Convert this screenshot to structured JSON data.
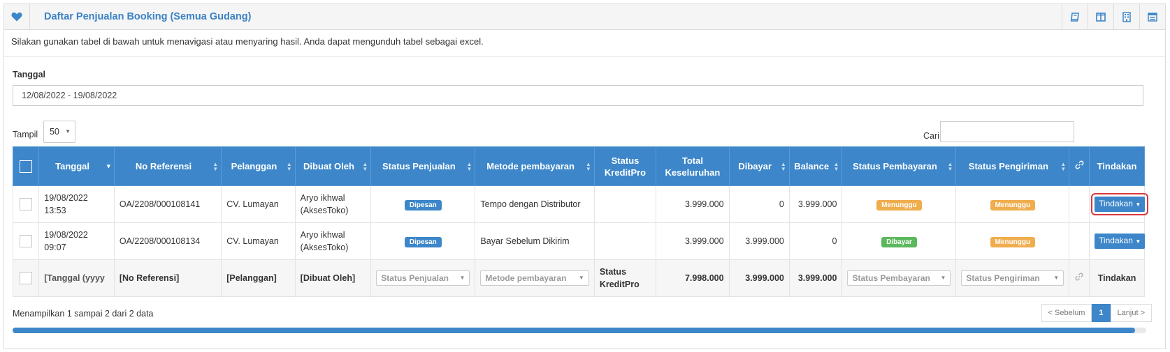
{
  "panel": {
    "title": "Daftar Penjualan Booking (Semua Gudang)",
    "title_icon": "heart-icon",
    "tools": [
      "book-icon",
      "columns-icon",
      "building-icon",
      "list-icon"
    ],
    "intro": "Silakan gunakan tabel di bawah untuk menavigasi atau menyaring hasil. Anda dapat mengunduh tabel sebagai excel."
  },
  "filter": {
    "date_label": "Tanggal",
    "date_value": "12/08/2022 - 19/08/2022"
  },
  "controls": {
    "show_label": "Tampil",
    "show_value": "50",
    "search_label": "Cari",
    "search_value": ""
  },
  "table": {
    "headers": {
      "tanggal": "Tanggal",
      "no_ref": "No Referensi",
      "pelanggan": "Pelanggan",
      "dibuat_oleh": "Dibuat Oleh",
      "status_penjualan": "Status Penjualan",
      "metode": "Metode pembayaran",
      "kreditpro": "Status KreditPro",
      "total": "Total Keseluruhan",
      "dibayar": "Dibayar",
      "balance": "Balance",
      "status_pembayaran": "Status Pembayaran",
      "status_pengiriman": "Status Pengiriman",
      "tindakan": "Tindakan"
    },
    "rows": [
      {
        "tanggal": "19/08/2022 13:53",
        "no_ref": "OA/2208/000108141",
        "pelanggan": "CV. Lumayan",
        "dibuat_oleh": "Aryo ikhwal (AksesToko)",
        "status_penjualan": "Dipesan",
        "metode": "Tempo dengan Distributor",
        "kreditpro": "",
        "total": "3.999.000",
        "dibayar": "0",
        "balance": "3.999.000",
        "status_pembayaran": "Menunggu",
        "status_pengiriman": "Menunggu",
        "action": "Tindakan"
      },
      {
        "tanggal": "19/08/2022 09:07",
        "no_ref": "OA/2208/000108134",
        "pelanggan": "CV. Lumayan",
        "dibuat_oleh": "Aryo ikhwal (AksesToko)",
        "status_penjualan": "Dipesan",
        "metode": "Bayar Sebelum Dikirim",
        "kreditpro": "",
        "total": "3.999.000",
        "dibayar": "3.999.000",
        "balance": "0",
        "status_pembayaran": "Dibayar",
        "status_pengiriman": "Menunggu",
        "action": "Tindakan"
      }
    ],
    "footer": {
      "tanggal": "[Tanggal (yyyy",
      "no_ref": "[No Referensi]",
      "pelanggan": "[Pelanggan]",
      "dibuat_oleh": "[Dibuat Oleh]",
      "status_penjualan": "Status Penjualan",
      "metode": "Metode pembayaran",
      "kreditpro": "Status KreditPro",
      "total": "7.998.000",
      "dibayar": "3.999.000",
      "balance": "3.999.000",
      "status_pembayaran": "Status Pembayaran",
      "status_pengiriman": "Status Pengiriman",
      "tindakan": "Tindakan"
    }
  },
  "pagination": {
    "info": "Menampilkan 1 sampai 2 dari 2 data",
    "prev": "< Sebelum",
    "current": "1",
    "next": "Lanjut >"
  },
  "colors": {
    "primary": "#3c86c9",
    "pending": "#f0ad4e",
    "paid": "#5cb85c",
    "highlight": "#d9383b"
  }
}
